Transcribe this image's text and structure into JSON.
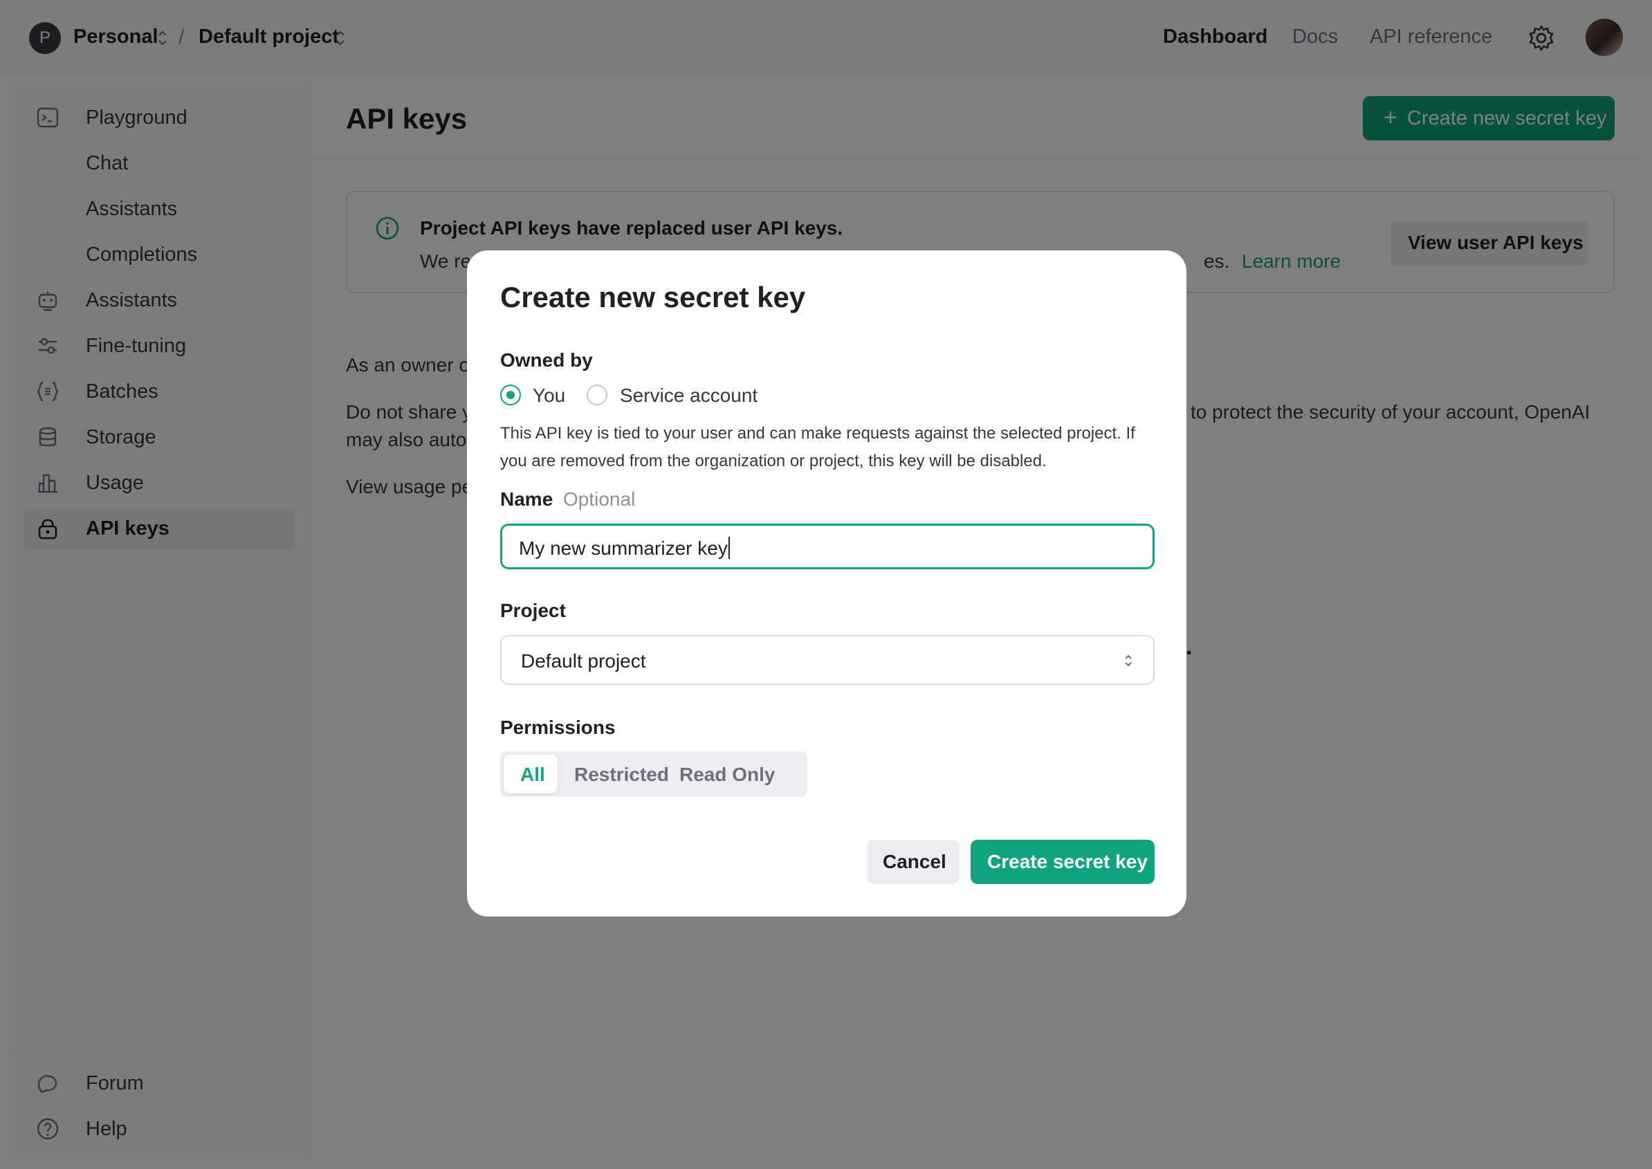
{
  "header": {
    "org_initial": "P",
    "org_name": "Personal",
    "separator": "/",
    "project_name": "Default project",
    "nav": [
      "Dashboard",
      "Docs",
      "API reference"
    ]
  },
  "sidebar": {
    "items": [
      {
        "label": "Playground",
        "icon": "terminal-icon"
      },
      {
        "label": "Chat"
      },
      {
        "label": "Assistants"
      },
      {
        "label": "Completions"
      },
      {
        "label": "Assistants",
        "icon": "robot-icon"
      },
      {
        "label": "Fine-tuning",
        "icon": "sliders-icon"
      },
      {
        "label": "Batches",
        "icon": "braces-icon"
      },
      {
        "label": "Storage",
        "icon": "database-icon"
      },
      {
        "label": "Usage",
        "icon": "bar-chart-icon"
      },
      {
        "label": "API keys",
        "icon": "lock-icon",
        "active": true
      }
    ],
    "footer": [
      {
        "label": "Forum",
        "icon": "chat-bubbles-icon"
      },
      {
        "label": "Help",
        "icon": "help-circle-icon"
      }
    ]
  },
  "main": {
    "title": "API keys",
    "create_button": "Create new secret key",
    "banner": {
      "title": "Project API keys have replaced user API keys.",
      "body_left": "We re",
      "body_right": "es.",
      "link": "Learn more",
      "button": "View user API keys"
    },
    "paragraphs": {
      "owner": "As an owner o",
      "share_left": "Do not share y",
      "share_right": "to protect the security of your account, OpenAI",
      "auto": "may also autor",
      "usage": "View usage pe",
      "stray": "l."
    }
  },
  "modal": {
    "title": "Create new secret key",
    "owned_by_label": "Owned by",
    "owner_options": [
      "You",
      "Service account"
    ],
    "owner_selected": "You",
    "help_text": "This API key is tied to your user and can make requests against the selected project. If you are removed from the organization or project, this key will be disabled.",
    "name_label": "Name",
    "name_optional": "Optional",
    "name_value": "My new summarizer key",
    "project_label": "Project",
    "project_value": "Default project",
    "permissions_label": "Permissions",
    "permissions": [
      "All",
      "Restricted",
      "Read Only"
    ],
    "permissions_selected": "All",
    "cancel": "Cancel",
    "submit": "Create secret key"
  },
  "colors": {
    "accent": "#10a37f",
    "overlay": "rgba(0,0,0,0.5)"
  }
}
